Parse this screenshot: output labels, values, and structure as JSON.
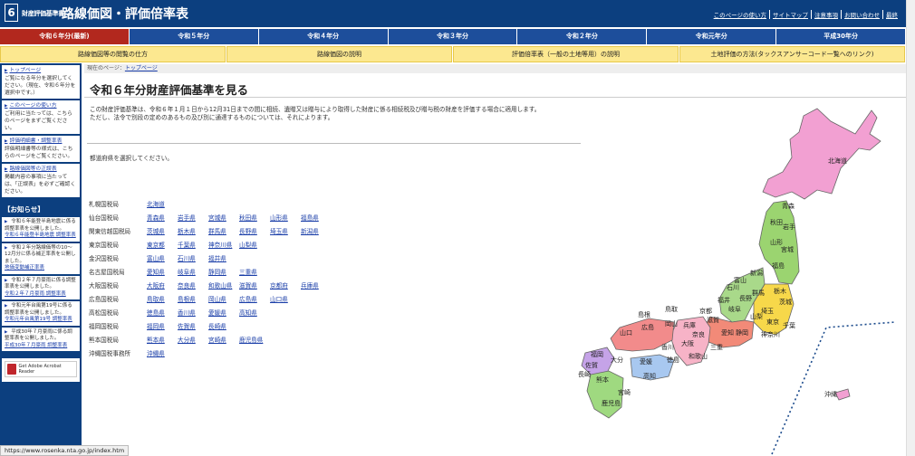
{
  "header": {
    "logo_number": "6",
    "logo_small": "財産評価基準書",
    "logo_title": "路線価図・評価倍率表",
    "util_links": [
      "このページの使い方",
      "サイトマップ",
      "注意事項",
      "お問い合わせ",
      "最終"
    ]
  },
  "year_tabs": [
    {
      "label": "令和６年分(最新)",
      "active": true
    },
    {
      "label": "令和５年分",
      "active": false
    },
    {
      "label": "令和４年分",
      "active": false
    },
    {
      "label": "令和３年分",
      "active": false
    },
    {
      "label": "令和２年分",
      "active": false
    },
    {
      "label": "令和元年分",
      "active": false
    },
    {
      "label": "平成30年分",
      "active": false
    }
  ],
  "sub_nav": [
    "路線価図等の閲覧の仕方",
    "路線価図の説明",
    "評価倍率表（一般の土地等用）の説明",
    "土地評価の方法(タックスアンサーコード一覧へのリンク)"
  ],
  "sidebar": {
    "cards": [
      {
        "head": "トップページ",
        "body": "ご覧になる年分を選択してください。（現在、令和６年分を選択中です。）"
      },
      {
        "head": "このページの使い方",
        "body": "ご利用に当たっては、こちらのページをまずご覧ください。"
      },
      {
        "head": "評価明細書・調整率表",
        "body": "評価明細書等の様式は、こちらのページをご覧ください。"
      },
      {
        "head": "路線価図等の正誤表",
        "body": "掲載内容の事項に当たっては、「正誤表」を必ずご確認ください。"
      }
    ],
    "news_title": "【お知らせ】",
    "news": [
      {
        "text": "令和６年能登半島地震に係る調整率表を公開しました。",
        "link": "令和６年能登半島地震 調整率表"
      },
      {
        "text": "令和２年分路線価等の10～12月分に係る補正率表を公開しました。",
        "link": "地価変動補正率表"
      },
      {
        "text": "令和２年７月豪雨に係る調整率表を公開しました。",
        "link": "令和２年７月豪雨 調整率表"
      },
      {
        "text": "令和元年台風第19号に係る調整率表を公開しました。",
        "link": "令和元年台風第19号 調整率表"
      },
      {
        "text": "平成30年７月豪雨に係る調整率表を公開しました。",
        "link": "平成30年７月豪雨 調整率表"
      }
    ],
    "acrobat": "Get Adobe Acrobat Reader"
  },
  "main": {
    "breadcrumb_prefix": "現在のページ：",
    "breadcrumb_link": "トップページ",
    "title": "令和６年分財産評価基準を見る",
    "intro1": "この財産評価基準は、令和６年１月１日から12月31日までの間に相続、遺贈又は贈与により取得した財産に係る相続税及び贈与税の財産を評価する場合に適用します。",
    "intro2": "ただし、法令で別段の定めのあるもの及び別に通達するものについては、それによります。",
    "select_prompt": "都道府県を選択してください。"
  },
  "bureaus": [
    {
      "name": "札幌国税局",
      "prefs": [
        "北海道"
      ]
    },
    {
      "name": "仙台国税局",
      "prefs": [
        "青森県",
        "岩手県",
        "宮城県",
        "秋田県",
        "山形県",
        "福島県"
      ]
    },
    {
      "name": "関東信越国税局",
      "prefs": [
        "茨城県",
        "栃木県",
        "群馬県",
        "長野県",
        "埼玉県",
        "新潟県"
      ]
    },
    {
      "name": "東京国税局",
      "prefs": [
        "東京都",
        "千葉県",
        "神奈川県",
        "山梨県"
      ]
    },
    {
      "name": "金沢国税局",
      "prefs": [
        "富山県",
        "石川県",
        "福井県"
      ]
    },
    {
      "name": "名古屋国税局",
      "prefs": [
        "愛知県",
        "岐阜県",
        "静岡県",
        "三重県"
      ]
    },
    {
      "name": "大阪国税局",
      "prefs": [
        "大阪府",
        "奈良県",
        "和歌山県",
        "滋賀県",
        "京都府",
        "兵庫県"
      ]
    },
    {
      "name": "広島国税局",
      "prefs": [
        "鳥取県",
        "島根県",
        "岡山県",
        "広島県",
        "山口県"
      ]
    },
    {
      "name": "高松国税局",
      "prefs": [
        "徳島県",
        "香川県",
        "愛媛県",
        "高知県"
      ]
    },
    {
      "name": "福岡国税局",
      "prefs": [
        "福岡県",
        "佐賀県",
        "長崎県"
      ]
    },
    {
      "name": "熊本国税局",
      "prefs": [
        "熊本県",
        "大分県",
        "宮崎県",
        "鹿児島県"
      ]
    },
    {
      "name": "沖縄国税事務所",
      "prefs": [
        "沖縄県"
      ]
    }
  ],
  "map_labels": [
    "北海道",
    "青森",
    "秋田",
    "岩手",
    "山形",
    "宮城",
    "新潟",
    "福島",
    "石川",
    "富山",
    "群馬",
    "栃木",
    "茨城",
    "長野",
    "埼玉",
    "千葉",
    "山梨",
    "東京",
    "神奈川",
    "福井",
    "岐阜",
    "静岡",
    "愛知",
    "滋賀",
    "京都",
    "三重",
    "兵庫",
    "大阪",
    "奈良",
    "和歌山",
    "鳥取",
    "島根",
    "岡山",
    "広島",
    "山口",
    "香川",
    "徳島",
    "愛媛",
    "高知",
    "福岡",
    "佐賀",
    "長崎",
    "大分",
    "熊本",
    "宮崎",
    "鹿児島",
    "沖縄"
  ],
  "status_url": "https://www.rosenka.nta.go.jp/index.htm"
}
